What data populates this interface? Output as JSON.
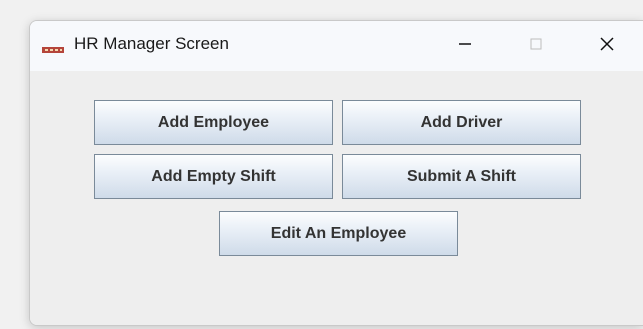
{
  "window": {
    "title": "HR Manager Screen",
    "icon": "java-cup-icon",
    "controls": {
      "minimize": "minimize-icon",
      "maximize": "maximize-icon",
      "close": "close-icon"
    }
  },
  "buttons": {
    "add_employee": "Add Employee",
    "add_driver": "Add Driver",
    "add_empty_shift": "Add Empty Shift",
    "submit_a_shift": "Submit A Shift",
    "edit_an_employee": "Edit An Employee"
  },
  "colors": {
    "button_border": "#7a8a99",
    "button_text": "#333333",
    "window_bg": "#eeeeee",
    "titlebar_bg": "#f7f9fc"
  }
}
